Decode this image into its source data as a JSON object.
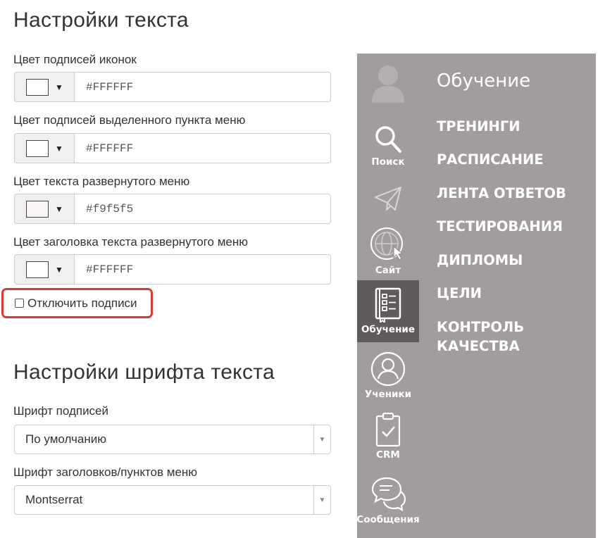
{
  "text_settings": {
    "title": "Настройки текста",
    "fields": [
      {
        "label": "Цвет подписей иконок",
        "value": "#FFFFFF",
        "swatch": "#ffffff"
      },
      {
        "label": "Цвет подписей выделенного пункта меню",
        "value": "#FFFFFF",
        "swatch": "#ffffff"
      },
      {
        "label": "Цвет текста развернутого меню",
        "value": "#f9f5f5",
        "swatch": "#f9f5f5"
      },
      {
        "label": "Цвет заголовка текста развернутого меню",
        "value": "#FFFFFF",
        "swatch": "#ffffff"
      }
    ],
    "disable_captions_label": "Отключить подписи",
    "disable_captions_checked": false
  },
  "font_settings": {
    "title": "Настройки шрифта текста",
    "caption_font_label": "Шрифт подписей",
    "caption_font_value": "По умолчанию",
    "heading_font_label": "Шрифт заголовков/пунктов меню",
    "heading_font_value": "Montserrat"
  },
  "preview": {
    "background": "#a19d9d",
    "active_background": "#5f5b5b",
    "icons": [
      {
        "icon": "avatar-icon",
        "label": ""
      },
      {
        "icon": "search-icon",
        "label": "Поиск"
      },
      {
        "icon": "paper-plane-icon",
        "label": ""
      },
      {
        "icon": "globe-icon",
        "label": "Сайт"
      },
      {
        "icon": "notebook-icon",
        "label": "Обучение",
        "active": true
      },
      {
        "icon": "user-circle-icon",
        "label": "Ученики"
      },
      {
        "icon": "clipboard-check-icon",
        "label": "CRM"
      },
      {
        "icon": "chat-bubbles-icon",
        "label": "Сообщения"
      }
    ],
    "menu_title": "Обучение",
    "menu_items": [
      "ТРЕНИНГИ",
      "РАСПИСАНИЕ",
      "ЛЕНТА ОТВЕТОВ",
      "ТЕСТИРОВАНИЯ",
      "ДИПЛОМЫ",
      "ЦЕЛИ",
      "КОНТРОЛЬ КАЧЕСТВА"
    ]
  }
}
